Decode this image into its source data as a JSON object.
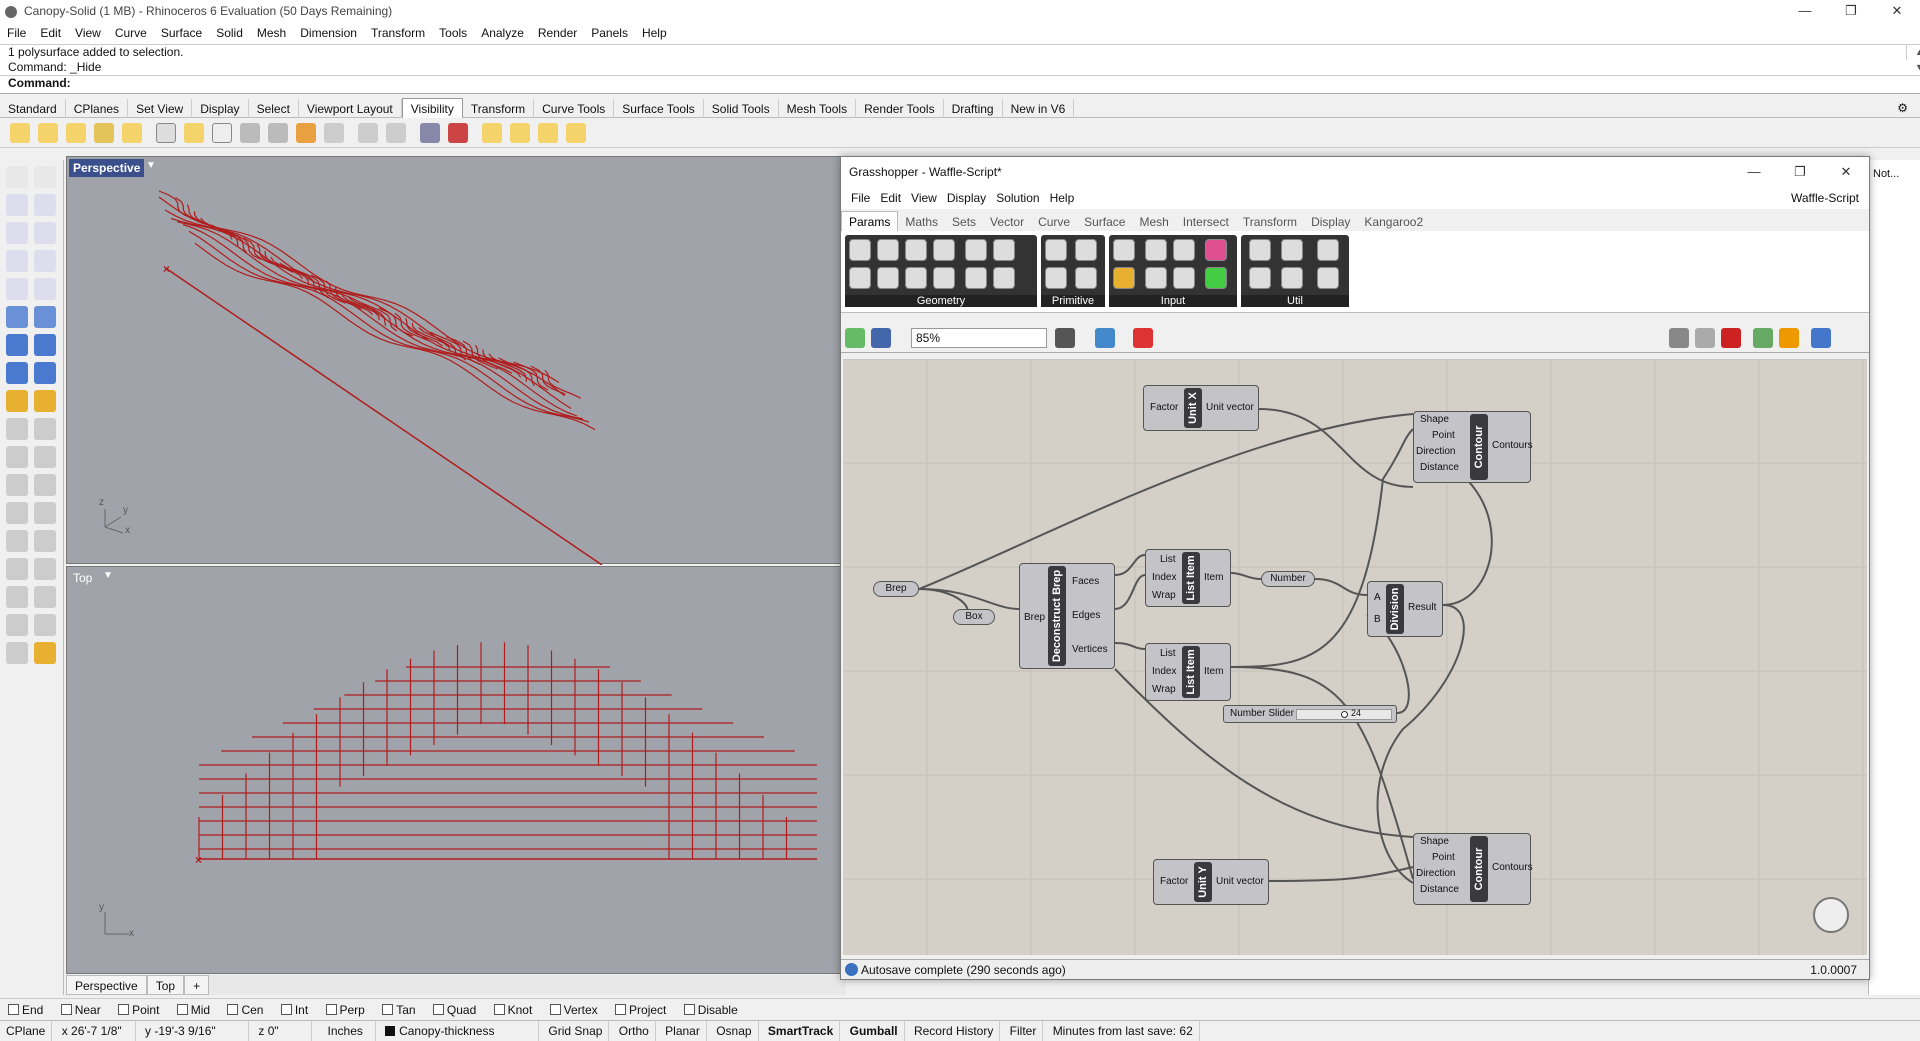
{
  "window": {
    "title": "Canopy-Solid (1 MB) - Rhinoceros 6 Evaluation (50 Days Remaining)",
    "minimize": "—",
    "restore": "❐",
    "close": "✕"
  },
  "menu": [
    "File",
    "Edit",
    "View",
    "Curve",
    "Surface",
    "Solid",
    "Mesh",
    "Dimension",
    "Transform",
    "Tools",
    "Analyze",
    "Render",
    "Panels",
    "Help"
  ],
  "command": {
    "line1": "1 polysurface added to selection.",
    "line2": "Command: _Hide",
    "prompt": "Command:"
  },
  "toolbar_tabs": [
    "Standard",
    "CPlanes",
    "Set View",
    "Display",
    "Select",
    "Viewport Layout",
    "Visibility",
    "Transform",
    "Curve Tools",
    "Surface Tools",
    "Solid Tools",
    "Mesh Tools",
    "Render Tools",
    "Drafting",
    "New in V6"
  ],
  "active_tab": "Visibility",
  "viewports": {
    "perspective": "Perspective",
    "top": "Top",
    "tab_perspective": "Perspective",
    "tab_top": "Top",
    "add_tab": "+"
  },
  "axis": {
    "x": "x",
    "y": "y",
    "z": "z"
  },
  "osnaps": [
    {
      "label": "End",
      "checked": false
    },
    {
      "label": "Near",
      "checked": false
    },
    {
      "label": "Point",
      "checked": false
    },
    {
      "label": "Mid",
      "checked": false
    },
    {
      "label": "Cen",
      "checked": false
    },
    {
      "label": "Int",
      "checked": false
    },
    {
      "label": "Perp",
      "checked": false
    },
    {
      "label": "Tan",
      "checked": false
    },
    {
      "label": "Quad",
      "checked": false
    },
    {
      "label": "Knot",
      "checked": false
    },
    {
      "label": "Vertex",
      "checked": false
    },
    {
      "label": "Project",
      "checked": false
    },
    {
      "label": "Disable",
      "checked": false
    }
  ],
  "status": {
    "cplane": "CPlane",
    "x": "x 26'-7 1/8\"",
    "y": "y -19'-3 9/16\"",
    "z": "z 0\"",
    "units": "Inches",
    "layer": "Canopy-thickness",
    "grid_snap": "Grid Snap",
    "ortho": "Ortho",
    "planar": "Planar",
    "osnap": "Osnap",
    "smarttrack": "SmartTrack",
    "gumball": "Gumball",
    "record": "Record History",
    "filter": "Filter",
    "save": "Minutes from last save: 62"
  },
  "right_panel": {
    "label": "Not..."
  },
  "grasshopper": {
    "title": "Grasshopper - Waffle-Script*",
    "doc_name": "Waffle-Script",
    "menu": [
      "File",
      "Edit",
      "View",
      "Display",
      "Solution",
      "Help"
    ],
    "tabs": [
      "Params",
      "Maths",
      "Sets",
      "Vector",
      "Curve",
      "Surface",
      "Mesh",
      "Intersect",
      "Transform",
      "Display",
      "Kangaroo2"
    ],
    "active_tab": "Params",
    "groups": [
      "Geometry",
      "Primitive",
      "Input",
      "Util"
    ],
    "zoom": "85%",
    "status": "Autosave complete (290 seconds ago)",
    "version": "1.0.0007",
    "components": {
      "unitx": {
        "name": "Unit X",
        "in": "Factor",
        "out": "Unit vector"
      },
      "unity": {
        "name": "Unit Y",
        "in": "Factor",
        "out": "Unit vector"
      },
      "contour1": {
        "name": "Contour",
        "inputs": [
          "Shape",
          "Point",
          "Direction",
          "Distance"
        ],
        "out": "Contours"
      },
      "contour2": {
        "name": "Contour",
        "inputs": [
          "Shape",
          "Point",
          "Direction",
          "Distance"
        ],
        "out": "Contours"
      },
      "brep": "Brep",
      "box": "Box",
      "deconstruct": {
        "name": "Deconstruct Brep",
        "in": "Brep",
        "outputs": [
          "Faces",
          "Edges",
          "Vertices"
        ]
      },
      "listitem1": {
        "name": "List Item",
        "inputs": [
          "List",
          "Index",
          "Wrap"
        ],
        "out": "Item"
      },
      "listitem2": {
        "name": "List Item",
        "inputs": [
          "List",
          "Index",
          "Wrap"
        ],
        "out": "Item"
      },
      "number": "Number",
      "division": {
        "name": "Division",
        "inputs": [
          "A",
          "B"
        ],
        "out": "Result"
      },
      "slider": {
        "label": "Number Slider",
        "value": "24",
        "fraction": 0.5
      }
    }
  },
  "colors": {
    "viewport_bg": "#a0a4aa",
    "curve": "#b01c1c",
    "gh_canvas": "#d4d0c8",
    "active_viewport": "#3a4f8c"
  }
}
